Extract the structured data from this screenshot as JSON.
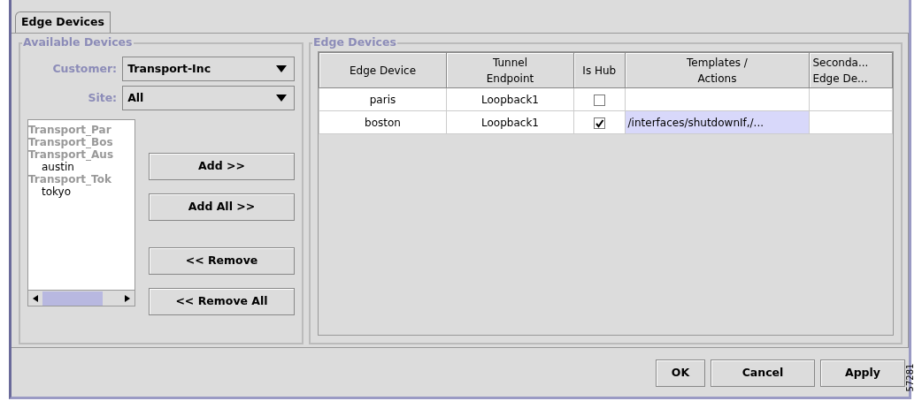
{
  "tabs": [
    {
      "label": "Edge Devices",
      "selected": true
    }
  ],
  "available_devices": {
    "title": "Available Devices",
    "customer": {
      "label": "Customer:",
      "value": "Transport-Inc"
    },
    "site": {
      "label": "Site:",
      "value": "All"
    },
    "tree": [
      {
        "label": "Transport_Par"
      },
      {
        "label": "Transport_Bos"
      },
      {
        "label": "Transport_Aus",
        "children": [
          {
            "label": "austin"
          }
        ]
      },
      {
        "label": "Transport_Tok",
        "children": [
          {
            "label": "tokyo"
          }
        ]
      }
    ],
    "buttons": [
      "Add >>",
      "Add All >>",
      "<< Remove",
      "<< Remove All"
    ]
  },
  "edge_devices": {
    "title": "Edge Devices",
    "columns": [
      "Edge Device",
      "Tunnel\nEndpoint",
      "Is Hub",
      "Templates /\nActions",
      "Seconda...\nEdge De..."
    ],
    "rows": [
      {
        "edge_device": "paris",
        "tunnel_endpoint": "Loopback1",
        "is_hub": false,
        "templates": "",
        "templates_selected": false
      },
      {
        "edge_device": "boston",
        "tunnel_endpoint": "Loopback1",
        "is_hub": true,
        "templates": "/interfaces/shutdownIf,/...",
        "templates_selected": true
      }
    ]
  },
  "footer_buttons": [
    "OK",
    "Cancel",
    "Apply"
  ],
  "figure_id": "57281"
}
